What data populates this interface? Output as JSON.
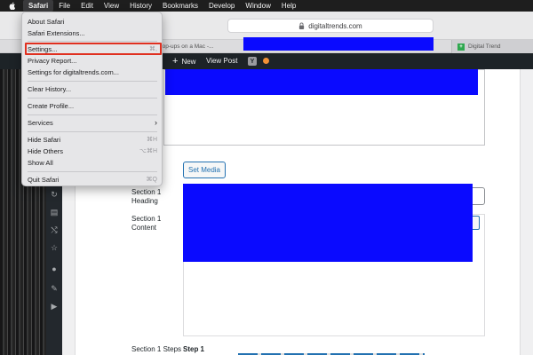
{
  "menubar": {
    "items": [
      "Safari",
      "File",
      "Edit",
      "View",
      "History",
      "Bookmarks",
      "Develop",
      "Window",
      "Help"
    ]
  },
  "browser": {
    "address": "digitaltrends.com",
    "tabs": {
      "popups": "llow pop-ups on a Mac -...",
      "digital": "Digital Trend"
    },
    "favicon_letter": "+"
  },
  "adminbar": {
    "new_label": "New",
    "view_label": "View Post",
    "yoast_letter": "Y"
  },
  "safari_menu": {
    "items": [
      {
        "label": "About Safari",
        "shortcut": ""
      },
      {
        "label": "Safari Extensions...",
        "shortcut": ""
      },
      {
        "label": "Settings...",
        "shortcut": "⌘,"
      },
      {
        "label": "Privacy Report...",
        "shortcut": ""
      },
      {
        "label": "Settings for digitaltrends.com...",
        "shortcut": ""
      },
      {
        "label": "Clear History...",
        "shortcut": ""
      },
      {
        "label": "Create Profile...",
        "shortcut": ""
      },
      {
        "label": "Services",
        "shortcut": "›"
      },
      {
        "label": "Hide Safari",
        "shortcut": "⌘H"
      },
      {
        "label": "Hide Others",
        "shortcut": "⌥⌘H"
      },
      {
        "label": "Show All",
        "shortcut": ""
      },
      {
        "label": "Quit Safari",
        "shortcut": "⌘Q"
      }
    ]
  },
  "editor": {
    "set_media": "Set Media",
    "section1_heading_label": "Section 1 Heading",
    "section1_content_label": "Section 1 Content",
    "section1_steps_label": "Section 1 Steps",
    "step_value": "Step 1"
  },
  "colors": {
    "redaction": "#0a0aff",
    "highlight": "#e03020",
    "wp_dark": "#1d2327"
  }
}
